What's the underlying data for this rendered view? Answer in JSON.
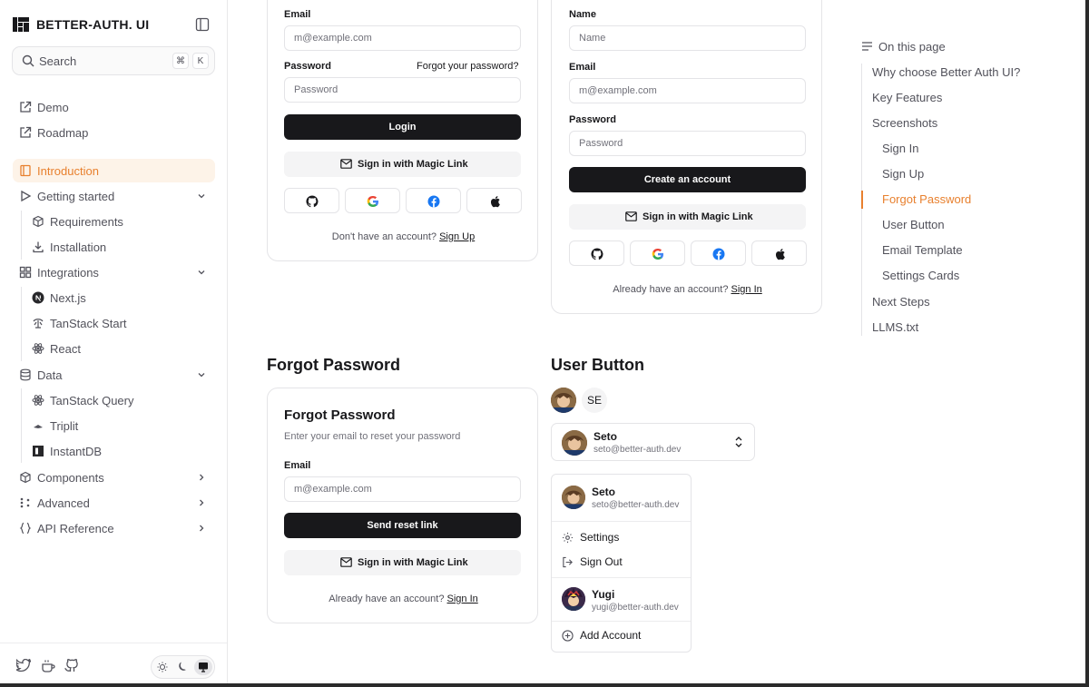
{
  "brand": {
    "name": "BETTER-AUTH. UI"
  },
  "search": {
    "placeholder": "Search",
    "kbd1": "⌘",
    "kbd2": "K"
  },
  "sidebar": {
    "links": [
      {
        "label": "Demo",
        "icon": "external-link-icon"
      },
      {
        "label": "Roadmap",
        "icon": "external-link-icon"
      }
    ],
    "items": [
      {
        "label": "Introduction",
        "icon": "book-icon"
      },
      {
        "label": "Getting started",
        "icon": "play-icon"
      },
      {
        "label": "Requirements",
        "icon": "box-icon"
      },
      {
        "label": "Installation",
        "icon": "download-icon"
      },
      {
        "label": "Integrations",
        "icon": "grid-icon"
      },
      {
        "label": "Next.js",
        "icon": "nextjs-icon"
      },
      {
        "label": "TanStack Start",
        "icon": "tanstack-icon"
      },
      {
        "label": "React",
        "icon": "react-icon"
      },
      {
        "label": "Data",
        "icon": "database-icon"
      },
      {
        "label": "TanStack Query",
        "icon": "react-icon"
      },
      {
        "label": "Triplit",
        "icon": "triplit-icon"
      },
      {
        "label": "InstantDB",
        "icon": "instantdb-icon"
      },
      {
        "label": "Components",
        "icon": "cube-icon"
      },
      {
        "label": "Advanced",
        "icon": "nodes-icon"
      },
      {
        "label": "API Reference",
        "icon": "braces-icon"
      }
    ]
  },
  "signin": {
    "email_label": "Email",
    "email_placeholder": "m@example.com",
    "password_label": "Password",
    "forgot_link": "Forgot your password?",
    "password_placeholder": "Password",
    "login_button": "Login",
    "magic_link": "Sign in with Magic Link",
    "footer_text": "Don't have an account?",
    "footer_link": "Sign Up"
  },
  "signup": {
    "name_label": "Name",
    "name_placeholder": "Name",
    "email_label": "Email",
    "email_placeholder": "m@example.com",
    "password_label": "Password",
    "password_placeholder": "Password",
    "create_button": "Create an account",
    "magic_link": "Sign in with Magic Link",
    "footer_text": "Already have an account?",
    "footer_link": "Sign In"
  },
  "forgot": {
    "section_heading": "Forgot Password",
    "title": "Forgot Password",
    "subtitle": "Enter your email to reset your password",
    "email_label": "Email",
    "email_placeholder": "m@example.com",
    "send_button": "Send reset link",
    "magic_link": "Sign in with Magic Link",
    "footer_text": "Already have an account?",
    "footer_link": "Sign In"
  },
  "user_button": {
    "section_heading": "User Button",
    "initials": "SE",
    "user": {
      "name": "Seto",
      "email": "seto@better-auth.dev"
    },
    "menu": {
      "settings": "Settings",
      "sign_out": "Sign Out",
      "other_user": {
        "name": "Yugi",
        "email": "yugi@better-auth.dev"
      },
      "add_account": "Add Account"
    }
  },
  "toc": {
    "title": "On this page",
    "items": [
      "Why choose Better Auth UI?",
      "Key Features",
      "Screenshots",
      "Sign In",
      "Sign Up",
      "Forgot Password",
      "User Button",
      "Email Template",
      "Settings Cards",
      "Next Steps",
      "LLMS.txt"
    ],
    "active": "Forgot Password"
  },
  "colors": {
    "accent": "#e8802e",
    "dark_button": "#18181b"
  }
}
